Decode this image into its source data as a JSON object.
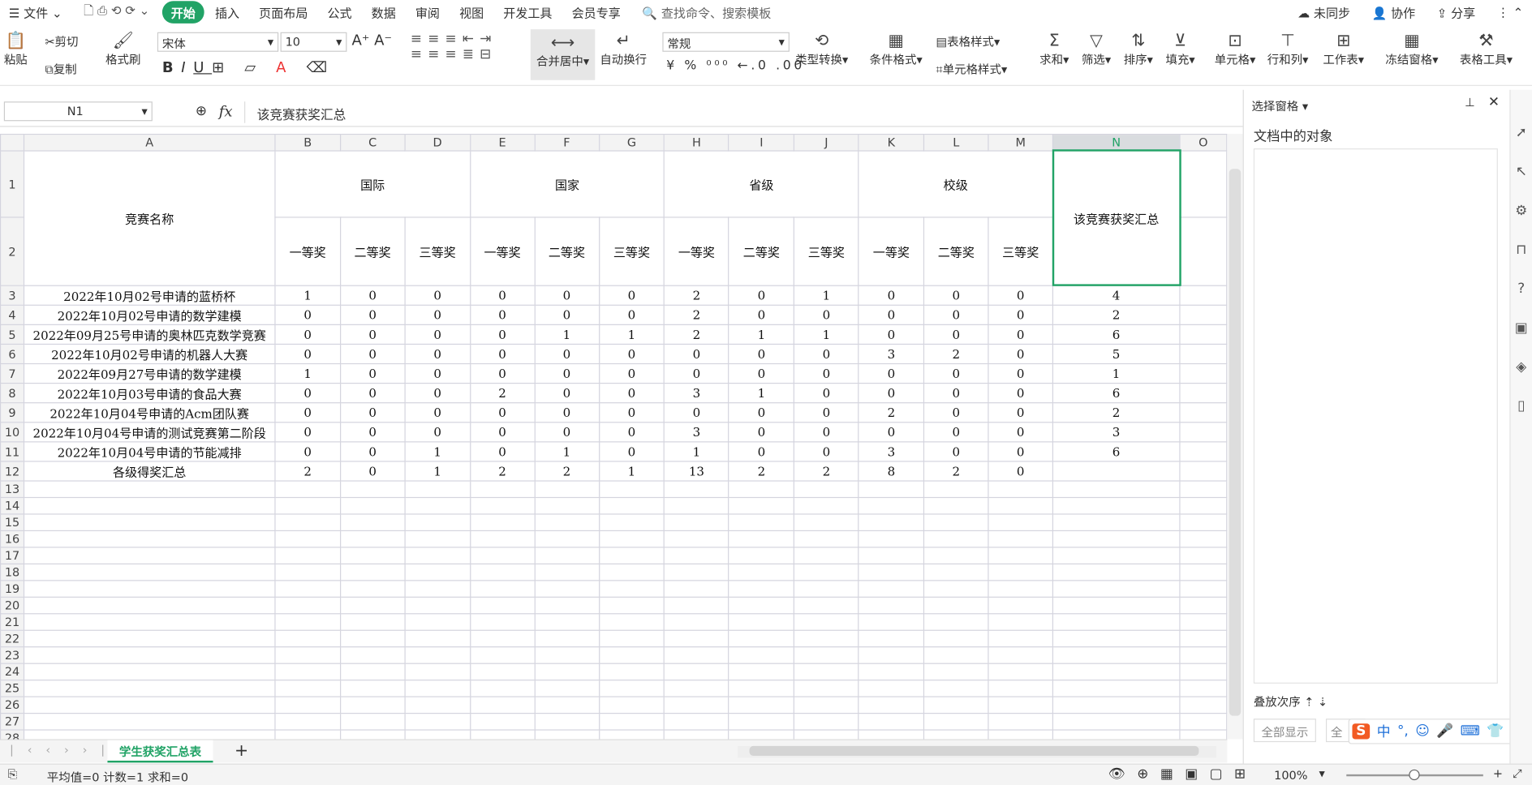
{
  "menu": {
    "file": "文件",
    "tabs": [
      "开始",
      "插入",
      "页面布局",
      "公式",
      "数据",
      "审阅",
      "视图",
      "开发工具",
      "会员专享"
    ],
    "search": "查找命令、搜索模板",
    "sync": "未同步",
    "collab": "协作",
    "share": "分享"
  },
  "ribbon": {
    "paste": "粘贴",
    "cut": "剪切",
    "copy": "复制",
    "format_painter": "格式刷",
    "font": "宋体",
    "size": "10",
    "merge": "合并居中",
    "wrap": "自动换行",
    "number_format": "常规",
    "convert": "类型转换",
    "cond_format": "条件格式",
    "table_style": "表格样式",
    "cell_style": "单元格样式",
    "sum": "求和",
    "filter": "筛选",
    "sort": "排序",
    "fill": "填充",
    "cell": "单元格",
    "rowcol": "行和列",
    "sheet": "工作表",
    "freeze": "冻结窗格",
    "tools": "表格工具"
  },
  "formula": {
    "cell_ref": "N1",
    "fx": "fx",
    "value": "该竞赛获奖汇总"
  },
  "columns": [
    "A",
    "B",
    "C",
    "D",
    "E",
    "F",
    "G",
    "H",
    "I",
    "J",
    "K",
    "L",
    "M",
    "N",
    "O"
  ],
  "header": {
    "name": "竞赛名称",
    "groups": [
      "国际",
      "国家",
      "省级",
      "校级"
    ],
    "prizes": [
      "一等奖",
      "二等奖",
      "三等奖"
    ],
    "total": "该竞赛获奖汇总"
  },
  "rows": [
    {
      "name": "2022年10月02号申请的蓝桥杯",
      "v": [
        "1",
        "0",
        "0",
        "0",
        "0",
        "0",
        "2",
        "0",
        "1",
        "0",
        "0",
        "0"
      ],
      "total": "4"
    },
    {
      "name": "2022年10月02号申请的数学建模",
      "v": [
        "0",
        "0",
        "0",
        "0",
        "0",
        "0",
        "2",
        "0",
        "0",
        "0",
        "0",
        "0"
      ],
      "total": "2"
    },
    {
      "name": "2022年09月25号申请的奥林匹克数学竞赛",
      "v": [
        "0",
        "0",
        "0",
        "0",
        "1",
        "1",
        "2",
        "1",
        "1",
        "0",
        "0",
        "0"
      ],
      "total": "6"
    },
    {
      "name": "2022年10月02号申请的机器人大赛",
      "v": [
        "0",
        "0",
        "0",
        "0",
        "0",
        "0",
        "0",
        "0",
        "0",
        "3",
        "2",
        "0"
      ],
      "total": "5"
    },
    {
      "name": "2022年09月27号申请的数学建模",
      "v": [
        "1",
        "0",
        "0",
        "0",
        "0",
        "0",
        "0",
        "0",
        "0",
        "0",
        "0",
        "0"
      ],
      "total": "1"
    },
    {
      "name": "2022年10月03号申请的食品大赛",
      "v": [
        "0",
        "0",
        "0",
        "2",
        "0",
        "0",
        "3",
        "1",
        "0",
        "0",
        "0",
        "0"
      ],
      "total": "6"
    },
    {
      "name": "2022年10月04号申请的Acm团队赛",
      "v": [
        "0",
        "0",
        "0",
        "0",
        "0",
        "0",
        "0",
        "0",
        "0",
        "2",
        "0",
        "0"
      ],
      "total": "2"
    },
    {
      "name": "2022年10月04号申请的测试竞赛第二阶段",
      "v": [
        "0",
        "0",
        "0",
        "0",
        "0",
        "0",
        "3",
        "0",
        "0",
        "0",
        "0",
        "0"
      ],
      "total": "3"
    },
    {
      "name": "2022年10月04号申请的节能减排",
      "v": [
        "0",
        "0",
        "1",
        "0",
        "1",
        "0",
        "1",
        "0",
        "0",
        "3",
        "0",
        "0"
      ],
      "total": "6"
    },
    {
      "name": "各级得奖汇总",
      "v": [
        "2",
        "0",
        "1",
        "2",
        "2",
        "1",
        "13",
        "2",
        "2",
        "8",
        "2",
        "0"
      ],
      "total": ""
    }
  ],
  "panel": {
    "title": "选择窗格",
    "objects": "文档中的对象",
    "order": "叠放次序",
    "show_all": "全部显示",
    "hide_all": "全"
  },
  "sheet_tab": "学生获奖汇总表",
  "status": {
    "text": "平均值=0  计数=1  求和=0",
    "zoom": "100%"
  },
  "ime": {
    "lang": "中"
  }
}
